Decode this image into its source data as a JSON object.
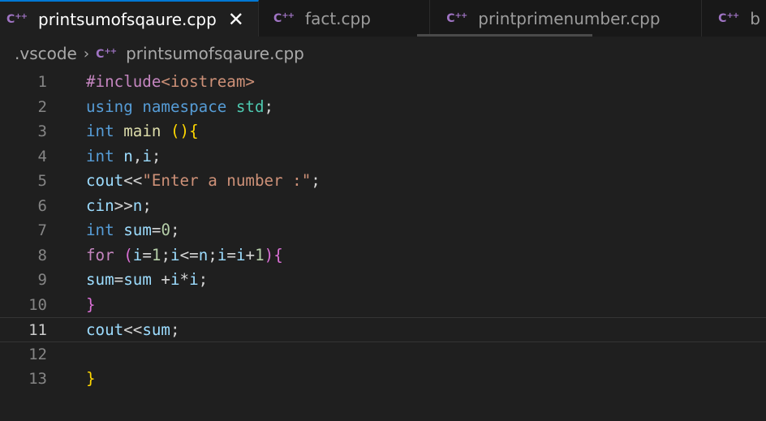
{
  "tabs": [
    {
      "label": "printsumofsqaure.cpp",
      "active": true,
      "close": "✕"
    },
    {
      "label": "fact.cpp",
      "active": false
    },
    {
      "label": "printprimenumber.cpp",
      "active": false
    },
    {
      "label": "b",
      "active": false
    }
  ],
  "file_icon": {
    "text": "C",
    "plus": "++"
  },
  "breadcrumb": {
    "folder": ".vscode",
    "separator": "›",
    "file": "printsumofsqaure.cpp"
  },
  "editor": {
    "current_line": 11,
    "line_numbers": [
      "1",
      "2",
      "3",
      "4",
      "5",
      "6",
      "7",
      "8",
      "9",
      "10",
      "11",
      "12",
      "13"
    ],
    "colors": {
      "keyword": "#569cd6",
      "control": "#c586c0",
      "string": "#ce9178",
      "number": "#b5cea8",
      "variable": "#9cdcfe",
      "function": "#dcdcaa",
      "namespace": "#4ec9b0"
    },
    "code": [
      [
        {
          "t": "inc",
          "v": "#include"
        },
        {
          "t": "str",
          "v": "<iostream>"
        }
      ],
      [
        {
          "t": "kw",
          "v": "using"
        },
        {
          "t": "op",
          "v": " "
        },
        {
          "t": "kw",
          "v": "namespace"
        },
        {
          "t": "op",
          "v": " "
        },
        {
          "t": "ns",
          "v": "std"
        },
        {
          "t": "op",
          "v": ";"
        }
      ],
      [
        {
          "t": "kw",
          "v": "int"
        },
        {
          "t": "op",
          "v": " "
        },
        {
          "t": "fn",
          "v": "main"
        },
        {
          "t": "op",
          "v": " "
        },
        {
          "t": "b1",
          "v": "()"
        },
        {
          "t": "b1",
          "v": "{"
        }
      ],
      [
        {
          "t": "kw",
          "v": "int"
        },
        {
          "t": "op",
          "v": " "
        },
        {
          "t": "var",
          "v": "n"
        },
        {
          "t": "op",
          "v": ","
        },
        {
          "t": "var",
          "v": "i"
        },
        {
          "t": "op",
          "v": ";"
        }
      ],
      [
        {
          "t": "var",
          "v": "cout"
        },
        {
          "t": "op",
          "v": "<<"
        },
        {
          "t": "str",
          "v": "\"Enter a number :\""
        },
        {
          "t": "op",
          "v": ";"
        }
      ],
      [
        {
          "t": "var",
          "v": "cin"
        },
        {
          "t": "op",
          "v": ">>"
        },
        {
          "t": "var",
          "v": "n"
        },
        {
          "t": "op",
          "v": ";"
        }
      ],
      [
        {
          "t": "kw",
          "v": "int"
        },
        {
          "t": "op",
          "v": " "
        },
        {
          "t": "var",
          "v": "sum"
        },
        {
          "t": "op",
          "v": "="
        },
        {
          "t": "num",
          "v": "0"
        },
        {
          "t": "op",
          "v": ";"
        }
      ],
      [
        {
          "t": "ctl",
          "v": "for"
        },
        {
          "t": "op",
          "v": " "
        },
        {
          "t": "b2",
          "v": "("
        },
        {
          "t": "var",
          "v": "i"
        },
        {
          "t": "op",
          "v": "="
        },
        {
          "t": "num",
          "v": "1"
        },
        {
          "t": "op",
          "v": ";"
        },
        {
          "t": "var",
          "v": "i"
        },
        {
          "t": "op",
          "v": "<="
        },
        {
          "t": "var",
          "v": "n"
        },
        {
          "t": "op",
          "v": ";"
        },
        {
          "t": "var",
          "v": "i"
        },
        {
          "t": "op",
          "v": "="
        },
        {
          "t": "var",
          "v": "i"
        },
        {
          "t": "op",
          "v": "+"
        },
        {
          "t": "num",
          "v": "1"
        },
        {
          "t": "b2",
          "v": ")"
        },
        {
          "t": "b2",
          "v": "{"
        }
      ],
      [
        {
          "t": "var",
          "v": "sum"
        },
        {
          "t": "op",
          "v": "="
        },
        {
          "t": "var",
          "v": "sum"
        },
        {
          "t": "op",
          "v": " +"
        },
        {
          "t": "var",
          "v": "i"
        },
        {
          "t": "op",
          "v": "*"
        },
        {
          "t": "var",
          "v": "i"
        },
        {
          "t": "op",
          "v": ";"
        }
      ],
      [
        {
          "t": "b2",
          "v": "}"
        }
      ],
      [
        {
          "t": "var",
          "v": "cout"
        },
        {
          "t": "op",
          "v": "<<"
        },
        {
          "t": "var",
          "v": "sum"
        },
        {
          "t": "op",
          "v": ";"
        }
      ],
      [],
      [
        {
          "t": "b1",
          "v": "}"
        }
      ]
    ]
  }
}
